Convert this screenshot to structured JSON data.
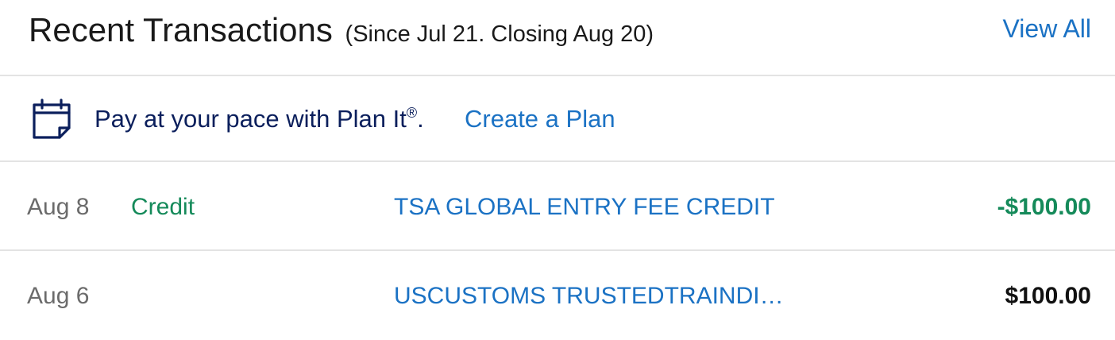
{
  "header": {
    "title": "Recent Transactions",
    "subtitle": "(Since Jul 21. Closing Aug 20)",
    "view_all": "View All"
  },
  "promo": {
    "icon": "calendar-icon",
    "text": "Pay at your pace with Plan It",
    "registered": "®",
    "period": ".",
    "link": "Create a Plan",
    "icon_color": "#0b1f5c"
  },
  "transactions": [
    {
      "date": "Aug 8",
      "tag": "Credit",
      "description": "TSA GLOBAL ENTRY FEE CREDIT",
      "amount": "-$100.00"
    },
    {
      "date": "Aug 6",
      "tag": "",
      "description": "USCUSTOMS TRUSTEDTRAINDI…",
      "amount": "$100.00"
    }
  ],
  "colors": {
    "link_blue": "#1b72c4",
    "credit_green": "#158a5a",
    "navy": "#0b1f5c",
    "divider": "#e3e3e3"
  }
}
